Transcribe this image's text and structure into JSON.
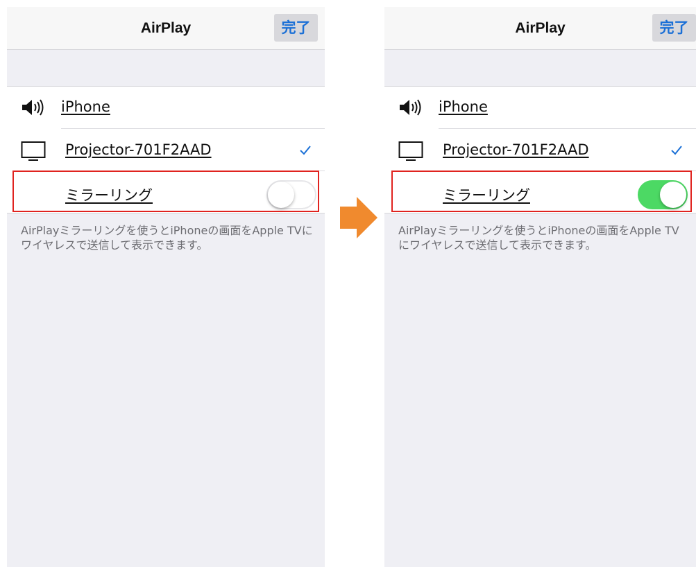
{
  "panels": [
    {
      "nav_title": "AirPlay",
      "done_label": "完了",
      "devices": [
        {
          "icon": "speaker-icon",
          "label": "iPhone",
          "selected": false
        },
        {
          "icon": "monitor-icon",
          "label": "Projector-701F2AAD",
          "selected": true
        }
      ],
      "mirroring_label": "ミラーリング",
      "mirroring_enabled": false,
      "footer": "AirPlayミラーリングを使うとiPhoneの画面をApple TVにワイヤレスで送信して表示できます。"
    },
    {
      "nav_title": "AirPlay",
      "done_label": "完了",
      "devices": [
        {
          "icon": "speaker-icon",
          "label": "iPhone",
          "selected": false
        },
        {
          "icon": "monitor-icon",
          "label": "Projector-701F2AAD",
          "selected": true
        }
      ],
      "mirroring_label": "ミラーリング",
      "mirroring_enabled": true,
      "footer": "AirPlayミラーリングを使うとiPhoneの画面をApple TVにワイヤレスで送信して表示できます。"
    }
  ],
  "colors": {
    "highlight": "#e0231f",
    "arrow": "#f08a2e",
    "toggle_on": "#4cd964",
    "accent": "#1a6fd6"
  }
}
